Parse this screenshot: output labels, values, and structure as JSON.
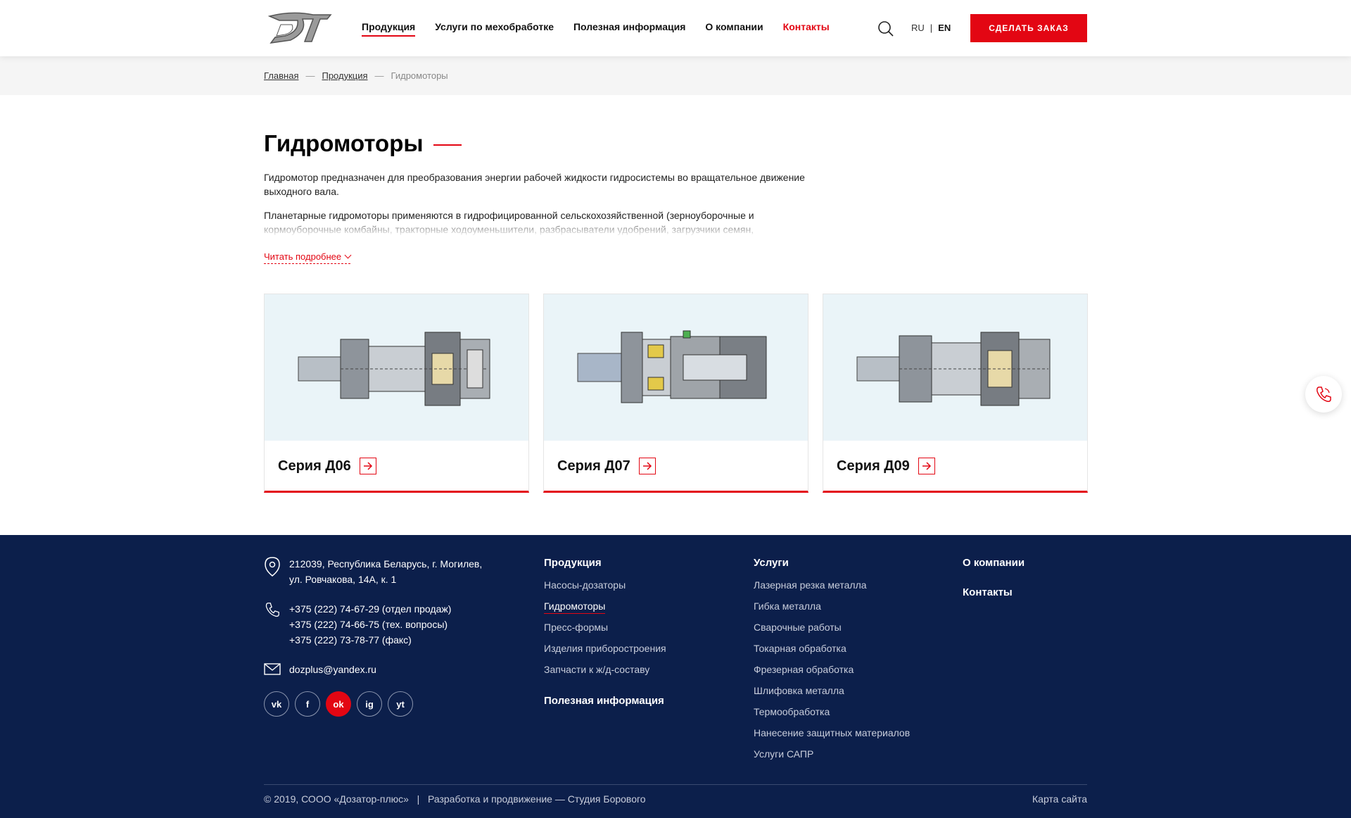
{
  "header": {
    "nav": [
      {
        "label": "Продукция",
        "active": true
      },
      {
        "label": "Услуги по мехобработке"
      },
      {
        "label": "Полезная информация"
      },
      {
        "label": "О компании"
      },
      {
        "label": "Контакты",
        "hovered": true
      }
    ],
    "lang": {
      "ru": "RU",
      "sep": "|",
      "en": "EN"
    },
    "order_button": "СДЕЛАТЬ ЗАКАЗ"
  },
  "breadcrumb": {
    "home": "Главная",
    "section": "Продукция",
    "current": "Гидромоторы",
    "sep": "—"
  },
  "page": {
    "title": "Гидромоторы",
    "p1": "Гидромотор предназначен для преобразования энергии рабочей жидкости гидросистемы во вращательное движение выходного вала.",
    "p2": "Планетарные гидромоторы применяются в гидрофицированной сельскохозяйственной (зерноуборочные и кормоуборочные комбайны, тракторные ходоуменьшители, разбрасыватели удобрений, загрузчики семян,",
    "read_more": "Читать подробнее"
  },
  "cards": [
    {
      "label": "Серия Д06"
    },
    {
      "label": "Серия Д07"
    },
    {
      "label": "Серия Д09"
    }
  ],
  "footer": {
    "address": [
      "212039, Республика Беларусь, г. Могилев,",
      "ул. Ровчакова, 14А, к. 1"
    ],
    "phones": [
      "+375 (222) 74-67-29 (отдел продаж)",
      "+375 (222) 74-66-75 (тех. вопросы)",
      "+375 (222) 73-78-77 (факс)"
    ],
    "email": "dozplus@yandex.ru",
    "socials": [
      "vk",
      "f",
      "ok",
      "ig",
      "yt"
    ],
    "products": {
      "title": "Продукция",
      "items": [
        "Насосы-дозаторы",
        "Гидромоторы",
        "Пресс-формы",
        "Изделия приборостроения",
        "Запчасти к ж/д-составу"
      ]
    },
    "useful": "Полезная информация",
    "services": {
      "title": "Услуги",
      "items": [
        "Лазерная резка металла",
        "Гибка металла",
        "Сварочные работы",
        "Токарная обработка",
        "Фрезерная обработка",
        "Шлифовка металла",
        "Термообработка",
        "Нанесение защитных материалов",
        "Услуги САПР"
      ]
    },
    "about": "О компании",
    "contacts": "Контакты",
    "copyright": "© 2019, СООО «Дозатор-плюс»",
    "divider": "|",
    "dev": "Разработка и продвижение — Студия Борового",
    "sitemap": "Карта сайта"
  }
}
